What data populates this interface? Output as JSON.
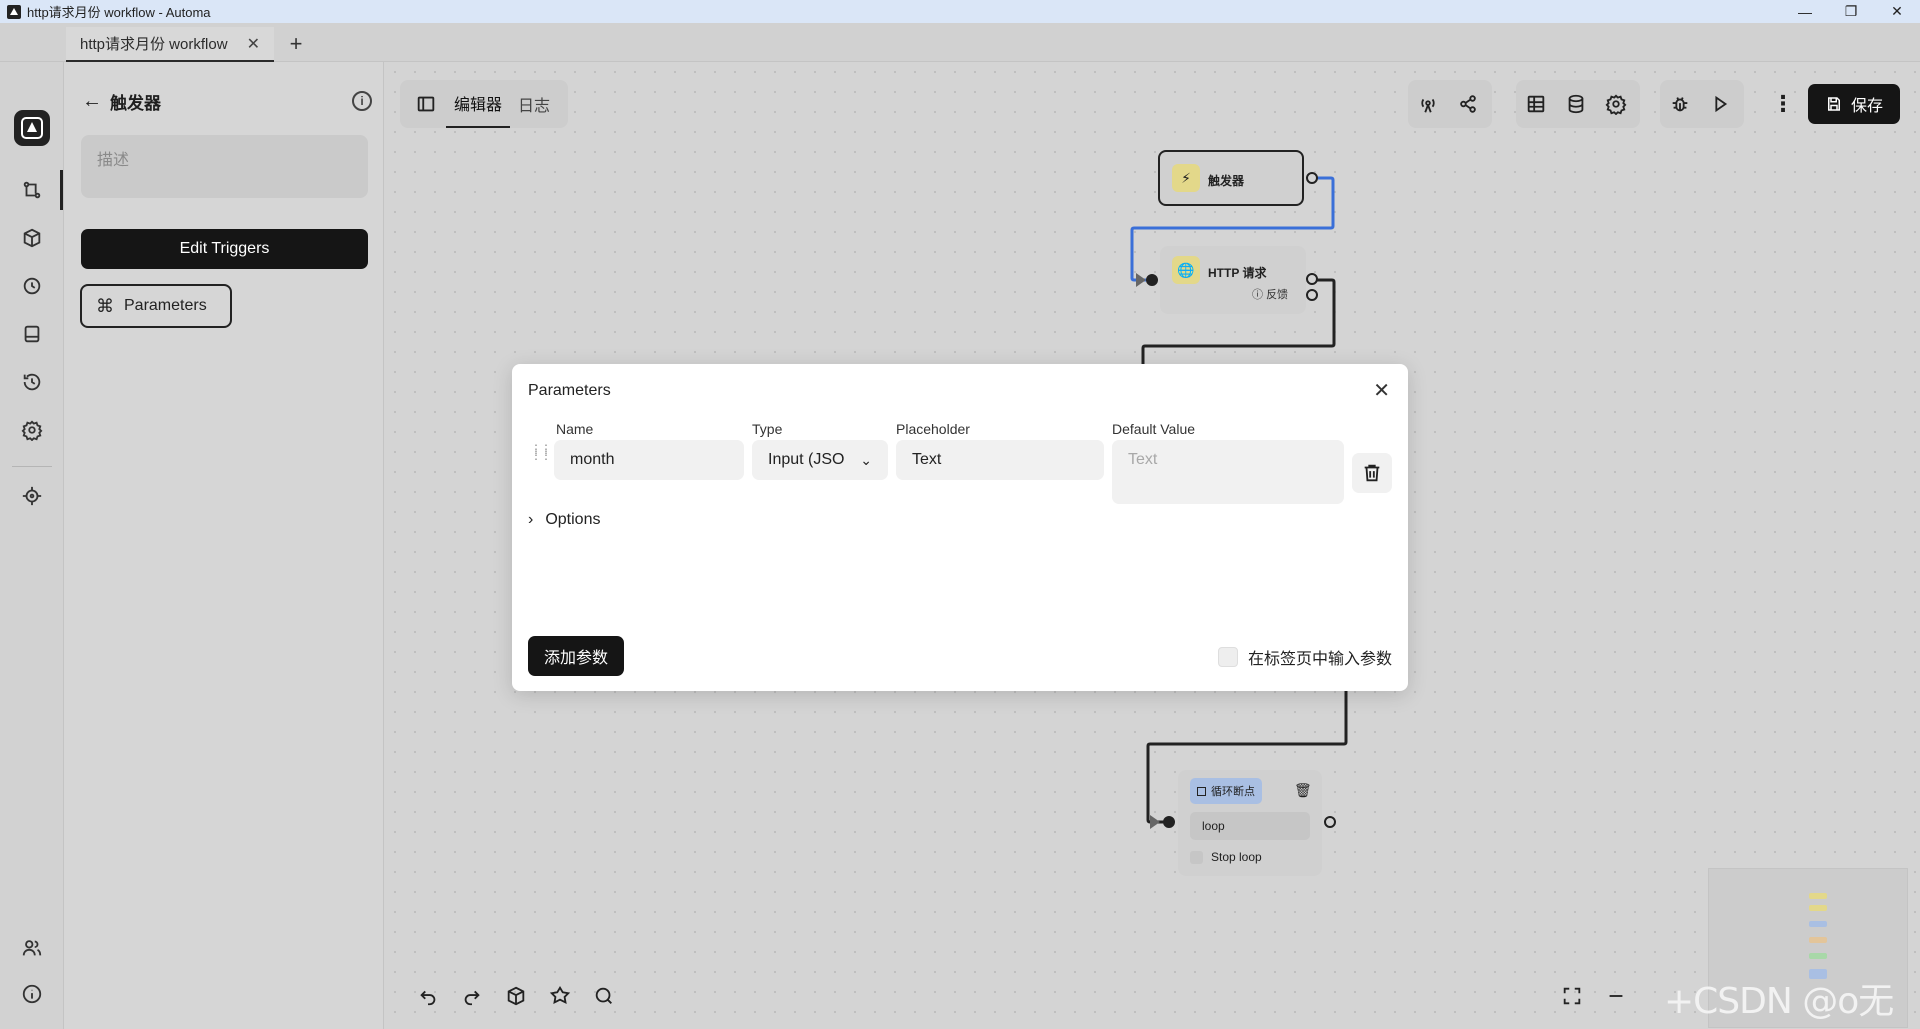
{
  "window": {
    "title": "http请求月份 workflow - Automa",
    "controls": [
      "—",
      "❐",
      "✕"
    ]
  },
  "tabs": [
    {
      "label": "http请求月份 workflow",
      "close": "✕"
    }
  ],
  "tab_add": "+",
  "sidebar": {
    "logo": "automa-logo",
    "items": [
      "workflow-icon",
      "package-icon",
      "clock-icon",
      "storage-icon",
      "history-icon",
      "settings-icon",
      "crosshair-icon",
      "users-icon",
      "info-icon"
    ]
  },
  "left_panel": {
    "back": "←",
    "title": "触发器",
    "description_placeholder": "描述",
    "edit_triggers_label": "Edit Triggers",
    "parameters_label": "Parameters",
    "parameters_icon": "⌘"
  },
  "editor_tabs": [
    {
      "label": "编辑器",
      "active": true
    },
    {
      "label": "日志",
      "active": false
    }
  ],
  "toolbar": {
    "save_label": "保存",
    "more": "⋮"
  },
  "nodes": {
    "trigger": {
      "label": "触发器",
      "icon": "⚡"
    },
    "http": {
      "label": "HTTP 请求",
      "fallback": "反馈",
      "icon": "🌐"
    },
    "loop_breakpoint": {
      "tag": "循环断点",
      "loop_id": "loop",
      "stop_loop": "Stop loop"
    }
  },
  "modal": {
    "title": "Parameters",
    "close": "✕",
    "columns": {
      "name": "Name",
      "type": "Type",
      "placeholder": "Placeholder",
      "default_value": "Default Value"
    },
    "row": {
      "name": "month",
      "type": "Input (JSO",
      "type_caret": "⌄",
      "placeholder": "Text",
      "default_value_placeholder": "Text"
    },
    "options_label": "Options",
    "options_chevron": "›",
    "add_param_label": "添加参数",
    "input_in_tab_label": "在标签页中输入参数"
  },
  "watermark": "+CSDN @o无颜o",
  "colors": {
    "accent_dark": "#151515",
    "connector_blue": "#3a6fd8",
    "node_icon_yellow": "#e3d88a",
    "loop_tag_blue": "#a9bfe3"
  }
}
